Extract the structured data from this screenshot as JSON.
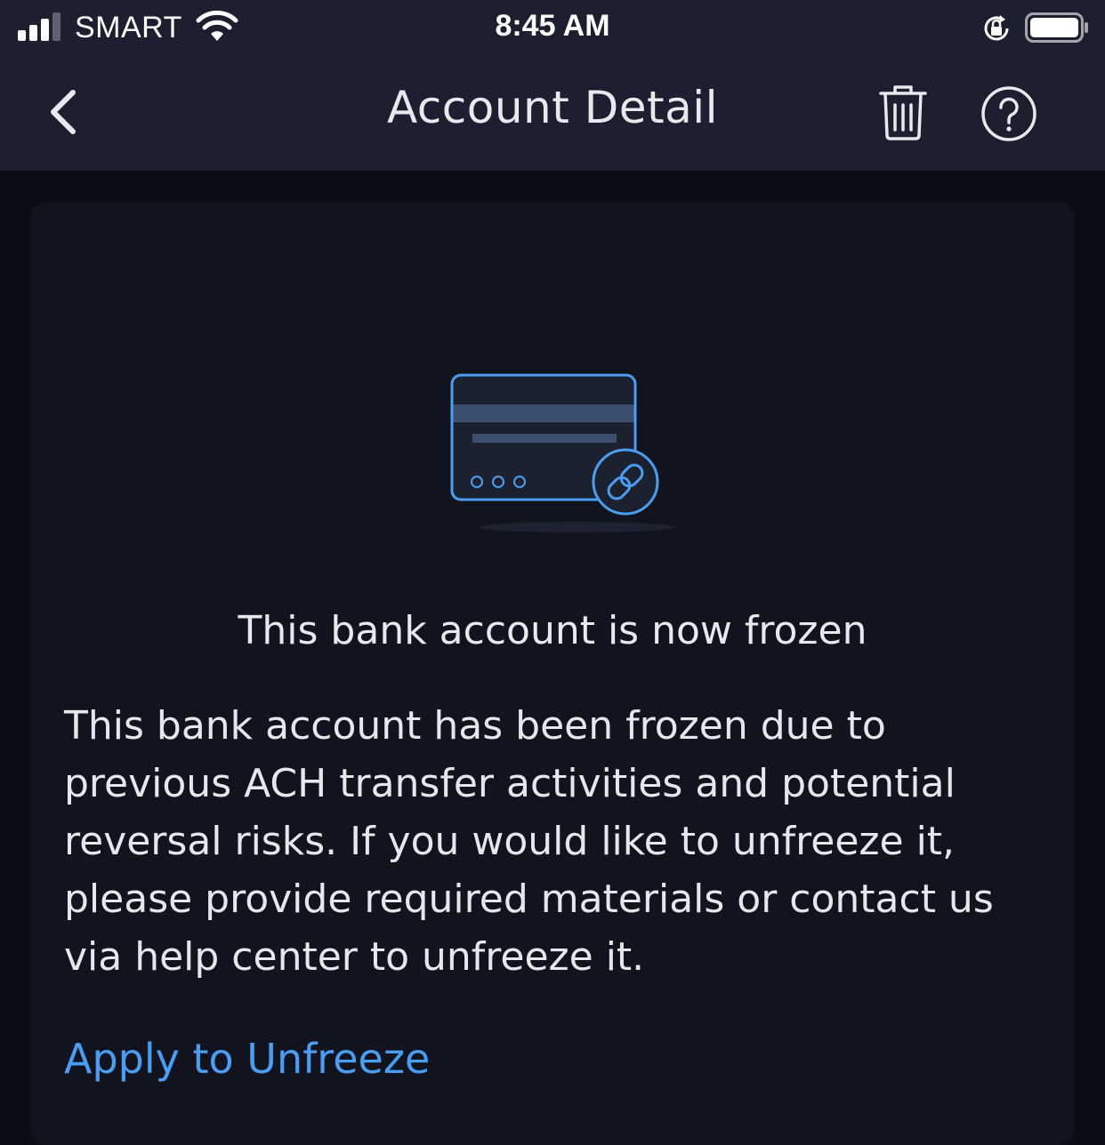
{
  "status_bar": {
    "carrier": "SMART",
    "time": "8:45 AM"
  },
  "nav": {
    "title": "Account Detail",
    "back_icon": "chevron-left-icon",
    "delete_icon": "trash-icon",
    "help_icon": "help-circle-icon"
  },
  "content": {
    "illustration_icon": "bank-card-link-icon",
    "heading": "This bank account is now frozen",
    "body": "This bank account has been frozen due to previous ACH transfer activities and potential reversal risks. If you would like to unfreeze it, please provide required materials or contact us via help center to unfreeze it.",
    "action_link": "Apply to Unfreeze"
  },
  "colors": {
    "header_bg": "#1b1f2f",
    "page_bg": "#0b0d16",
    "card_bg": "#11131f",
    "accent": "#4a9df0"
  }
}
